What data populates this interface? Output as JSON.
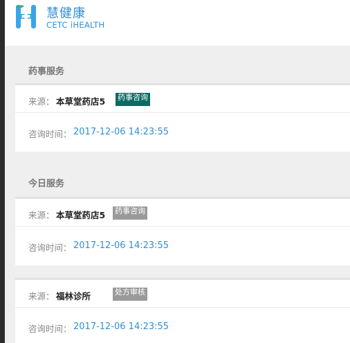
{
  "brand": {
    "name": "慧健康",
    "subtitle": "CETC iHEALTH"
  },
  "labels": {
    "source": "来源：",
    "consult_time": "咨询时间："
  },
  "sections": [
    {
      "title": "药事服务",
      "cards": [
        {
          "source": "本草堂药店5",
          "tag": "药事咨询",
          "time": "2017-12-06 14:23:55"
        }
      ]
    },
    {
      "title": "今日服务",
      "cards": [
        {
          "source": "本草堂药店5",
          "tag": "药事咨询",
          "time": "2017-12-06 14:23:55"
        },
        {
          "source": "福林诊所",
          "tag": "处方审核",
          "time": "2017-12-06 14:23:55"
        }
      ]
    }
  ],
  "colors": {
    "brand_blue": "#2f8fd8",
    "tag_green": "#0a6b63",
    "tag_gray": "#9a9a9a"
  },
  "icons": {
    "logo": "ihealth-logo-icon"
  }
}
